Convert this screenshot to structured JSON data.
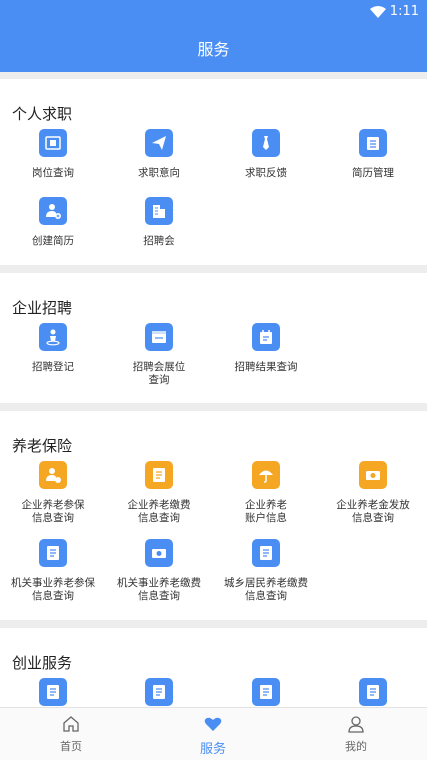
{
  "status": {
    "time": "1:11"
  },
  "header": {
    "title": "服务"
  },
  "sections": [
    {
      "title": "个人求职",
      "items": [
        "岗位查询",
        "求职意向",
        "求职反馈",
        "简历管理",
        "创建简历",
        "招聘会"
      ]
    },
    {
      "title": "企业招聘",
      "items": [
        "招聘登记",
        "招聘会展位\n查询",
        "招聘结果查询"
      ]
    },
    {
      "title": "养老保险",
      "items": [
        "企业养老参保\n信息查询",
        "企业养老缴费\n信息查询",
        "企业养老\n账户信息",
        "企业养老金发放\n信息查询",
        "机关事业养老参保\n信息查询",
        "机关事业养老缴费\n信息查询",
        "城乡居民养老缴费\n信息查询"
      ]
    },
    {
      "title": "创业服务"
    }
  ],
  "tabs": [
    {
      "label": "首页"
    },
    {
      "label": "服务"
    },
    {
      "label": "我的"
    }
  ],
  "colors": {
    "primary": "#4a8ef4",
    "orange": "#f5a623"
  }
}
